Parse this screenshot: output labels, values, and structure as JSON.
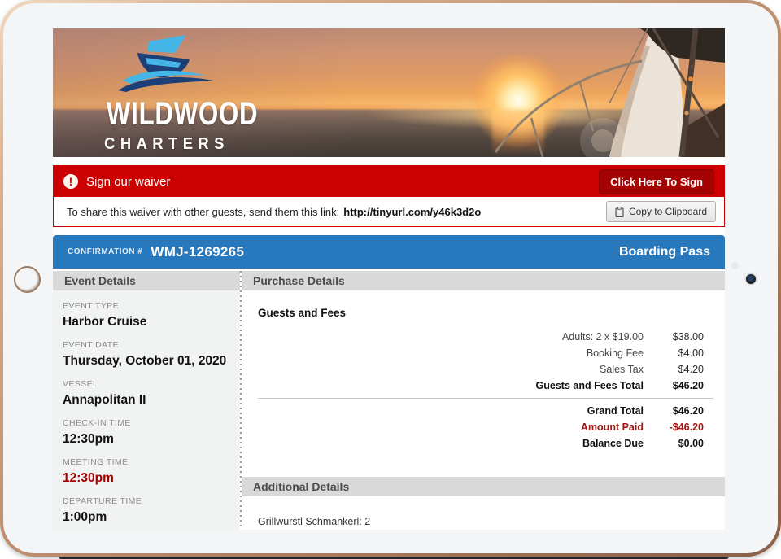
{
  "banner": {
    "logo_line1": "WILDWOOD",
    "logo_line2": "CHARTERS"
  },
  "waiver": {
    "title": "Sign our waiver",
    "sign_button": "Click Here To Sign",
    "share_text": "To share this waiver with other guests, send them this link:",
    "share_link": "http://tinyurl.com/y46k3d2o",
    "copy_button": "Copy to Clipboard"
  },
  "confirmation": {
    "label": "CONFIRMATION #",
    "number": "WMJ-1269265",
    "boarding_pass": "Boarding Pass"
  },
  "event_details": {
    "title": "Event Details",
    "fields": [
      {
        "label": "EVENT TYPE",
        "value": "Harbor Cruise",
        "highlight": false
      },
      {
        "label": "EVENT DATE",
        "value": "Thursday, October 01, 2020",
        "highlight": false
      },
      {
        "label": "VESSEL",
        "value": "Annapolitan II",
        "highlight": false
      },
      {
        "label": "CHECK-IN TIME",
        "value": "12:30pm",
        "highlight": false
      },
      {
        "label": "MEETING TIME",
        "value": "12:30pm",
        "highlight": true
      },
      {
        "label": "DEPARTURE TIME",
        "value": "1:00pm",
        "highlight": false
      }
    ]
  },
  "purchase_details": {
    "title": "Purchase Details",
    "section_heading": "Guests and Fees",
    "fee_rows": [
      {
        "label": "Adults: 2 x $19.00",
        "amount": "$38.00",
        "bold": false,
        "red": false
      },
      {
        "label": "Booking Fee",
        "amount": "$4.00",
        "bold": false,
        "red": false
      },
      {
        "label": "Sales Tax",
        "amount": "$4.20",
        "bold": false,
        "red": false
      },
      {
        "label": "Guests and Fees Total",
        "amount": "$46.20",
        "bold": true,
        "red": false
      }
    ],
    "summary_rows": [
      {
        "label": "Grand Total",
        "amount": "$46.20",
        "bold": true,
        "red": false
      },
      {
        "label": "Amount Paid",
        "amount": "-$46.20",
        "bold": true,
        "red": true
      },
      {
        "label": "Balance Due",
        "amount": "$0.00",
        "bold": true,
        "red": false
      }
    ]
  },
  "additional_details": {
    "title": "Additional Details",
    "text": "Grillwurstl Schmankerl: 2"
  },
  "colors": {
    "banner_red": "#cc0001",
    "sign_button_red": "#a40303",
    "confirmation_blue": "#2878be",
    "alert_text_red": "#a40000",
    "section_header_gray": "#d9d9d9"
  }
}
